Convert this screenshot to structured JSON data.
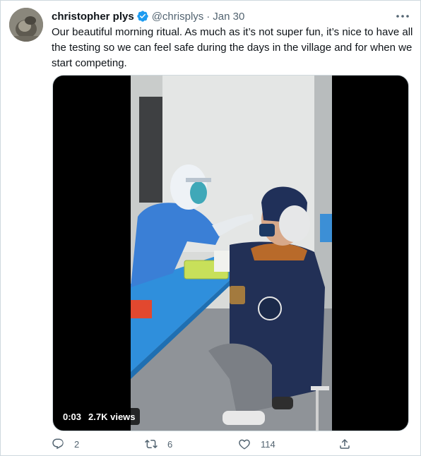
{
  "tweet": {
    "author_name": "christopher plys",
    "handle": "@chrisplys",
    "separator": "·",
    "date": "Jan 30",
    "text": "Our beautiful morning ritual. As much as it’s not super fun, it’s nice to have all the testing so we can feel safe during the days in the village and for when we start competing."
  },
  "video": {
    "elapsed": "0:03",
    "views": "2.7K views"
  },
  "actions": {
    "replies": "2",
    "retweets": "6",
    "likes": "114"
  },
  "colors": {
    "verified": "#1d9bf0",
    "secondary_text": "#536471",
    "border": "#cfd9de"
  },
  "icons": [
    "verified-badge-icon",
    "more-icon",
    "reply-icon",
    "retweet-icon",
    "like-icon",
    "share-icon"
  ]
}
